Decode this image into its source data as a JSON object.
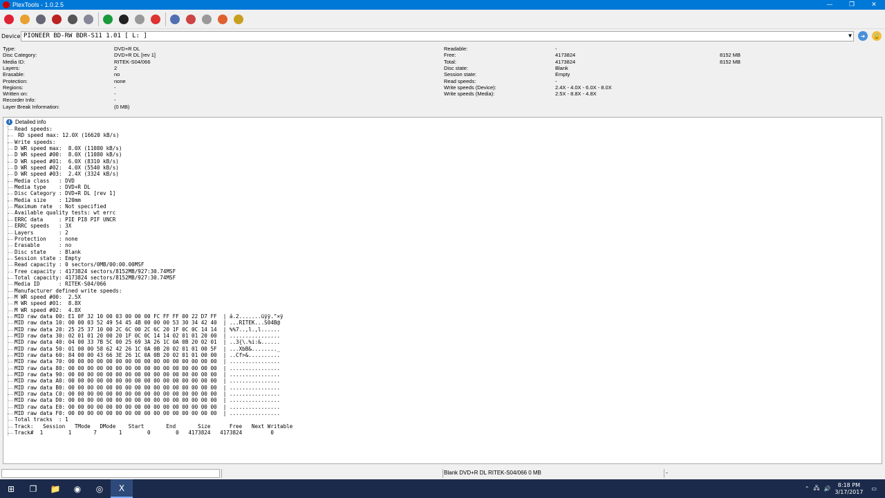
{
  "window": {
    "title": "PlexTools - 1.0.2.5"
  },
  "titlebar_buttons": {
    "minimize": "—",
    "maximize": "❐",
    "close": "✕"
  },
  "toolbar_icons": [
    {
      "name": "power-icon",
      "color": "#d23"
    },
    {
      "name": "disc-info-icon",
      "color": "#e8a030"
    },
    {
      "name": "drive-info-icon",
      "color": "#667"
    },
    {
      "name": "eject-icon",
      "color": "#b22"
    },
    {
      "name": "load-icon",
      "color": "#555"
    },
    {
      "name": "settings-icon",
      "color": "#889"
    },
    {
      "name": "refresh-icon",
      "color": "#1a9a3a"
    },
    {
      "name": "scan-icon",
      "color": "#222"
    },
    {
      "name": "speed-icon",
      "color": "#999"
    },
    {
      "name": "stop-icon",
      "color": "#d33"
    },
    {
      "name": "test-icon",
      "color": "#5070b0"
    },
    {
      "name": "burn-icon",
      "color": "#c44"
    },
    {
      "name": "copy-icon",
      "color": "#999"
    },
    {
      "name": "about-icon",
      "color": "#e06030"
    },
    {
      "name": "chart-icon",
      "color": "#c8a020"
    }
  ],
  "device": {
    "label": "Device:",
    "value": "PIONEER   BD-RW   BDR-S11  1.01 [ L: ]"
  },
  "disc_info_left": [
    {
      "key": "Type:",
      "value": "DVD+R DL"
    },
    {
      "key": "Disc Category:",
      "value": "DVD+R DL [rev 1]"
    },
    {
      "key": "Media ID:",
      "value": "RITEK-S04/066"
    },
    {
      "key": "Layers:",
      "value": "2"
    },
    {
      "key": "Erasable:",
      "value": "no"
    },
    {
      "key": "Protection:",
      "value": "none"
    },
    {
      "key": "Regions:",
      "value": "-"
    },
    {
      "key": "Written on:",
      "value": "-"
    },
    {
      "key": "Recorder Info:",
      "value": "-"
    },
    {
      "key": "Layer Break Information:",
      "value": "(0 MB)"
    }
  ],
  "disc_info_right": [
    {
      "key": "Readable:",
      "value": "-",
      "extra": ""
    },
    {
      "key": "Free:",
      "value": "4173824",
      "extra": "8152 MB"
    },
    {
      "key": "Total:",
      "value": "4173824",
      "extra": "8152 MB"
    },
    {
      "key": "Disc state:",
      "value": "Blank",
      "extra": ""
    },
    {
      "key": "Session state:",
      "value": "Empty",
      "extra": ""
    },
    {
      "key": "Read speeds:",
      "value": "-",
      "extra": ""
    },
    {
      "key": "Write speeds (Device):",
      "value": "2.4X - 4.0X - 6.0X - 8.0X",
      "extra": ""
    },
    {
      "key": "Write speeds (Media):",
      "value": "2.5X - 8.8X - 4.8X",
      "extra": ""
    }
  ],
  "detail": {
    "root_label": "Detailed info",
    "lines": [
      {
        "t": "Read speeds:",
        "sub": false
      },
      {
        "t": "RD speed max: 12.0X (16620 kB/s)",
        "sub": true
      },
      {
        "t": "Write speeds:",
        "sub": false
      },
      {
        "t": "D WR speed max:  8.0X (11080 kB/s)",
        "sub": false
      },
      {
        "t": "D WR speed #00:  8.0X (11080 kB/s)",
        "sub": false
      },
      {
        "t": "D WR speed #01:  6.0X (8310 kB/s)",
        "sub": false
      },
      {
        "t": "D WR speed #02:  4.0X (5540 kB/s)",
        "sub": false
      },
      {
        "t": "D WR speed #03:  2.4X (3324 kB/s)",
        "sub": false
      },
      {
        "t": "Media class   : DVD",
        "sub": false
      },
      {
        "t": "Media type    : DVD+R DL",
        "sub": false
      },
      {
        "t": "Disc Category : DVD+R DL [rev 1]",
        "sub": false
      },
      {
        "t": "Media size    : 120mm",
        "sub": false
      },
      {
        "t": "Maximum rate  : Not specified",
        "sub": false
      },
      {
        "t": "Available quality tests: wt errc",
        "sub": false
      },
      {
        "t": "ERRC data     : PIE PI8 PIF UNCR",
        "sub": false
      },
      {
        "t": "ERRC speeds   : 3X",
        "sub": false
      },
      {
        "t": "Layers        : 2",
        "sub": false
      },
      {
        "t": "Protection    : none",
        "sub": false
      },
      {
        "t": "Erasable      : no",
        "sub": false
      },
      {
        "t": "Disc state    : Blank",
        "sub": false
      },
      {
        "t": "Session state : Empty",
        "sub": false
      },
      {
        "t": "Read capacity : 0 sectors/0MB/00:00.00MSF",
        "sub": false
      },
      {
        "t": "Free capacity : 4173824 sectors/8152MB/927:30.74MSF",
        "sub": false
      },
      {
        "t": "Total capacity: 4173824 sectors/8152MB/927:30.74MSF",
        "sub": false
      },
      {
        "t": "Media ID      : RITEK-S04/066",
        "sub": false
      },
      {
        "t": "Manufacturer defined write speeds:",
        "sub": false
      },
      {
        "t": "M WR speed #00:  2.5X",
        "sub": false
      },
      {
        "t": "M WR speed #01:  8.8X",
        "sub": false
      },
      {
        "t": "M WR speed #02:  4.8X",
        "sub": false
      },
      {
        "t": "MID raw data 00: E1 0F 32 10 00 03 00 00 00 FC FF FF 00 22 D7 FF  | á.2.......üÿÿ.\"×ÿ",
        "sub": false
      },
      {
        "t": "MID raw data 10: 00 00 03 52 49 54 45 4B 00 00 00 53 30 34 42 40  | ...RITEK...S04B@",
        "sub": false
      },
      {
        "t": "MID raw data 20: 25 25 37 10 00 2C 6C 00 2C 6C 20 1F 0C 0C 14 14  | %%7..,l.,l......",
        "sub": false
      },
      {
        "t": "MID raw data 30: 02 01 01 20 00 20 1F 0C 0C 14 14 02 01 01 20 00  | ................",
        "sub": false
      },
      {
        "t": "MID raw data 40: 04 00 33 7B 5C 00 25 69 3A 26 1C 0A 0B 20 02 01  | ..3{\\.%i:&......",
        "sub": false
      },
      {
        "t": "MID raw data 50: 01 00 00 58 62 42 26 1C 0A 0B 20 02 01 01 00 5F  | ...XbB&........_",
        "sub": false
      },
      {
        "t": "MID raw data 60: 84 00 00 43 66 3E 26 1C 0A 0B 20 02 01 01 00 00  | ..Cf>&..........",
        "sub": false
      },
      {
        "t": "MID raw data 70: 00 00 00 00 00 00 00 00 00 00 00 00 00 00 00 00  | ................",
        "sub": false
      },
      {
        "t": "MID raw data 80: 00 00 00 00 00 00 00 00 00 00 00 00 00 00 00 00  | ................",
        "sub": false
      },
      {
        "t": "MID raw data 90: 00 00 00 00 00 00 00 00 00 00 00 00 00 00 00 00  | ................",
        "sub": false
      },
      {
        "t": "MID raw data A0: 00 00 00 00 00 00 00 00 00 00 00 00 00 00 00 00  | ................",
        "sub": false
      },
      {
        "t": "MID raw data B0: 00 00 00 00 00 00 00 00 00 00 00 00 00 00 00 00  | ................",
        "sub": false
      },
      {
        "t": "MID raw data C0: 00 00 00 00 00 00 00 00 00 00 00 00 00 00 00 00  | ................",
        "sub": false
      },
      {
        "t": "MID raw data D0: 00 00 00 00 00 00 00 00 00 00 00 00 00 00 00 00  | ................",
        "sub": false
      },
      {
        "t": "MID raw data E0: 00 00 00 00 00 00 00 00 00 00 00 00 00 00 00 00  | ................",
        "sub": false
      },
      {
        "t": "MID raw data F0: 00 00 00 00 00 00 00 00 00 00 00 00 00 00 00 00  | ................",
        "sub": false
      },
      {
        "t": "Total tracks  : 1",
        "sub": false
      },
      {
        "t": "Track:   Session   TMode   DMode    Start       End       Size      Free   Next Writable",
        "sub": false
      },
      {
        "t": "Track#  1        1       7       1        0        0   4173824   4173824         0",
        "sub": false
      }
    ]
  },
  "statusbar": {
    "text": "Blank   DVD+R DL   RITEK-S04/066   0 MB",
    "right": "-"
  },
  "taskbar": {
    "items": [
      {
        "name": "start-icon",
        "glyph": "⊞",
        "active": false
      },
      {
        "name": "task-view-icon",
        "glyph": "❐",
        "active": false
      },
      {
        "name": "file-explorer-icon",
        "glyph": "📁",
        "active": false
      },
      {
        "name": "chrome-icon",
        "glyph": "◉",
        "active": false
      },
      {
        "name": "plextools-icon",
        "glyph": "◎",
        "active": false
      },
      {
        "name": "app-x-icon",
        "glyph": "X",
        "active": true
      }
    ],
    "time": "8:18 PM",
    "date": "3/17/2017"
  }
}
